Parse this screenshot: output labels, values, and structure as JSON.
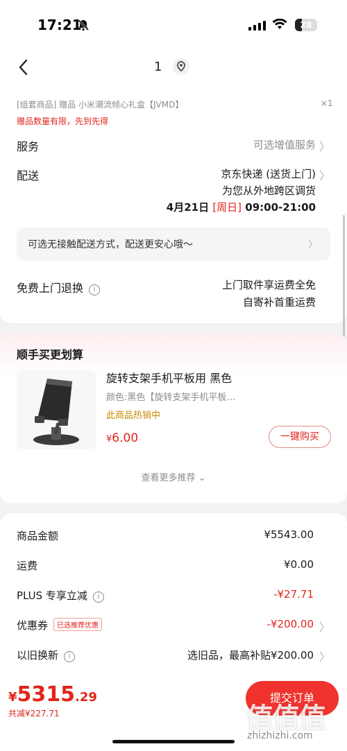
{
  "status_bar": {
    "time": "17:21",
    "battery": "28"
  },
  "nav": {
    "title": "1"
  },
  "gift": {
    "text": "[组套商品] 赠品 小米潮流倾心礼盒【JVMD】",
    "qty": "×1",
    "limit_note": "赠品数量有限，先到先得"
  },
  "service": {
    "label": "服务",
    "value": "可选增值服务"
  },
  "delivery": {
    "label": "配送",
    "line1": "京东快递 (送货上门)",
    "line2": "为您从外地跨区调货",
    "date": "4月21日",
    "weekday": "[周日]",
    "time": "09:00-21:00"
  },
  "contactless": {
    "text": "可选无接触配送方式，配送更安心哦～"
  },
  "free_return": {
    "label": "免费上门退换",
    "line1": "上门取件享运费全免",
    "line2": "自寄补首重运费"
  },
  "addon": {
    "title": "顺手买更划算",
    "product_name": "旋转支架手机平板用 黑色",
    "spec": "颜色:黑色【旋转支架手机平板…",
    "hot": "此商品热销中",
    "price_symbol": "¥",
    "price": "6.00",
    "buy_label": "一键购买",
    "more": "查看更多推荐"
  },
  "summary": {
    "goods_label": "商品金额",
    "goods_value": "¥5543.00",
    "shipping_label": "运费",
    "shipping_value": "¥0.00",
    "plus_label": "PLUS 专享立减",
    "plus_value": "-¥27.71",
    "coupon_label": "优惠券",
    "coupon_tag": "已选推荐优惠",
    "coupon_value": "-¥200.00",
    "tradein_label": "以旧换新",
    "tradein_value": "选旧品，最高补贴¥200.00"
  },
  "footer": {
    "total_symbol": "¥",
    "total_int": "5315",
    "total_dec": ".29",
    "saved": "共减¥227.71",
    "submit_label": "提交订单"
  },
  "watermark": {
    "logo": "值值值",
    "url": "zhizhizhi.com"
  },
  "colors": {
    "accent": "#e1251b",
    "button": "#f0332e",
    "hot": "#c98a00"
  }
}
